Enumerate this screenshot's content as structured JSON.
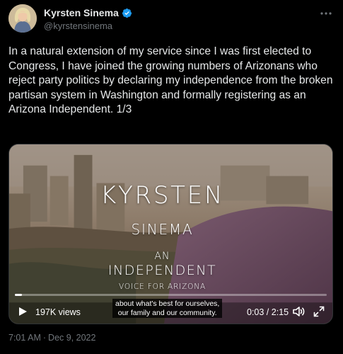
{
  "author": {
    "display_name": "Kyrsten Sinema",
    "handle": "@kyrstensinema",
    "verified_icon": "verified-badge-icon",
    "verified_color": "#1d9bf0"
  },
  "tweet": {
    "text": "In a natural extension of my service since I was first elected to Congress, I have joined the growing numbers of Arizonans who reject party politics by declaring my independence from the broken partisan system in Washington and formally registering as an Arizona Independent. 1/3"
  },
  "video": {
    "overlay": {
      "first_name": "KYRSTEN",
      "last_name": "SINEMA",
      "an": "AN",
      "independent": "INDEPENDENT",
      "voice": "VOICE FOR ARIZONA"
    },
    "caption_line1": "about what's best for ourselves,",
    "caption_line2": "our family and our community.",
    "views": "197K views",
    "time": "0:03 / 2:15",
    "progress": 0.022
  },
  "meta": {
    "time": "7:01 AM",
    "separator": "·",
    "date": "Dec 9, 2022"
  },
  "colors": {
    "background": "#000000",
    "text": "#e7e9ea",
    "secondary": "#71767b",
    "accent": "#1d9bf0"
  }
}
